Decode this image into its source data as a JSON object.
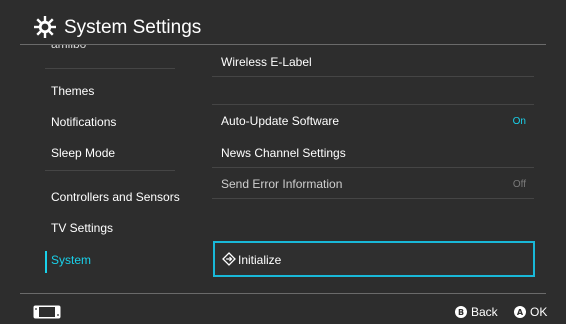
{
  "header": {
    "title": "System Settings",
    "icon": "gear-icon"
  },
  "sidebar": {
    "partial_item": "amiibo",
    "items": [
      {
        "label": "Themes"
      },
      {
        "label": "Notifications"
      },
      {
        "label": "Sleep Mode"
      },
      {
        "label": "Controllers and Sensors"
      },
      {
        "label": "TV Settings"
      },
      {
        "label": "System",
        "selected": true
      }
    ]
  },
  "main": {
    "rows": [
      {
        "label": "Wireless E-Label"
      },
      {
        "label": "Auto-Update Software",
        "value": "On"
      },
      {
        "label": "News Channel Settings"
      },
      {
        "label": "Send Error Information",
        "value": "Off"
      },
      {
        "label": "Initialize",
        "focused": true,
        "icon": "initialize-diamond-icon"
      }
    ]
  },
  "footer": {
    "console_icon": "console-icon",
    "buttons": [
      {
        "glyph": "B",
        "label": "Back"
      },
      {
        "glyph": "A",
        "label": "OK"
      }
    ]
  },
  "colors": {
    "background": "#2d2d2d",
    "accent": "#19d1ea",
    "focus_border": "#19b8d8",
    "off_text": "#7a7a7a"
  }
}
